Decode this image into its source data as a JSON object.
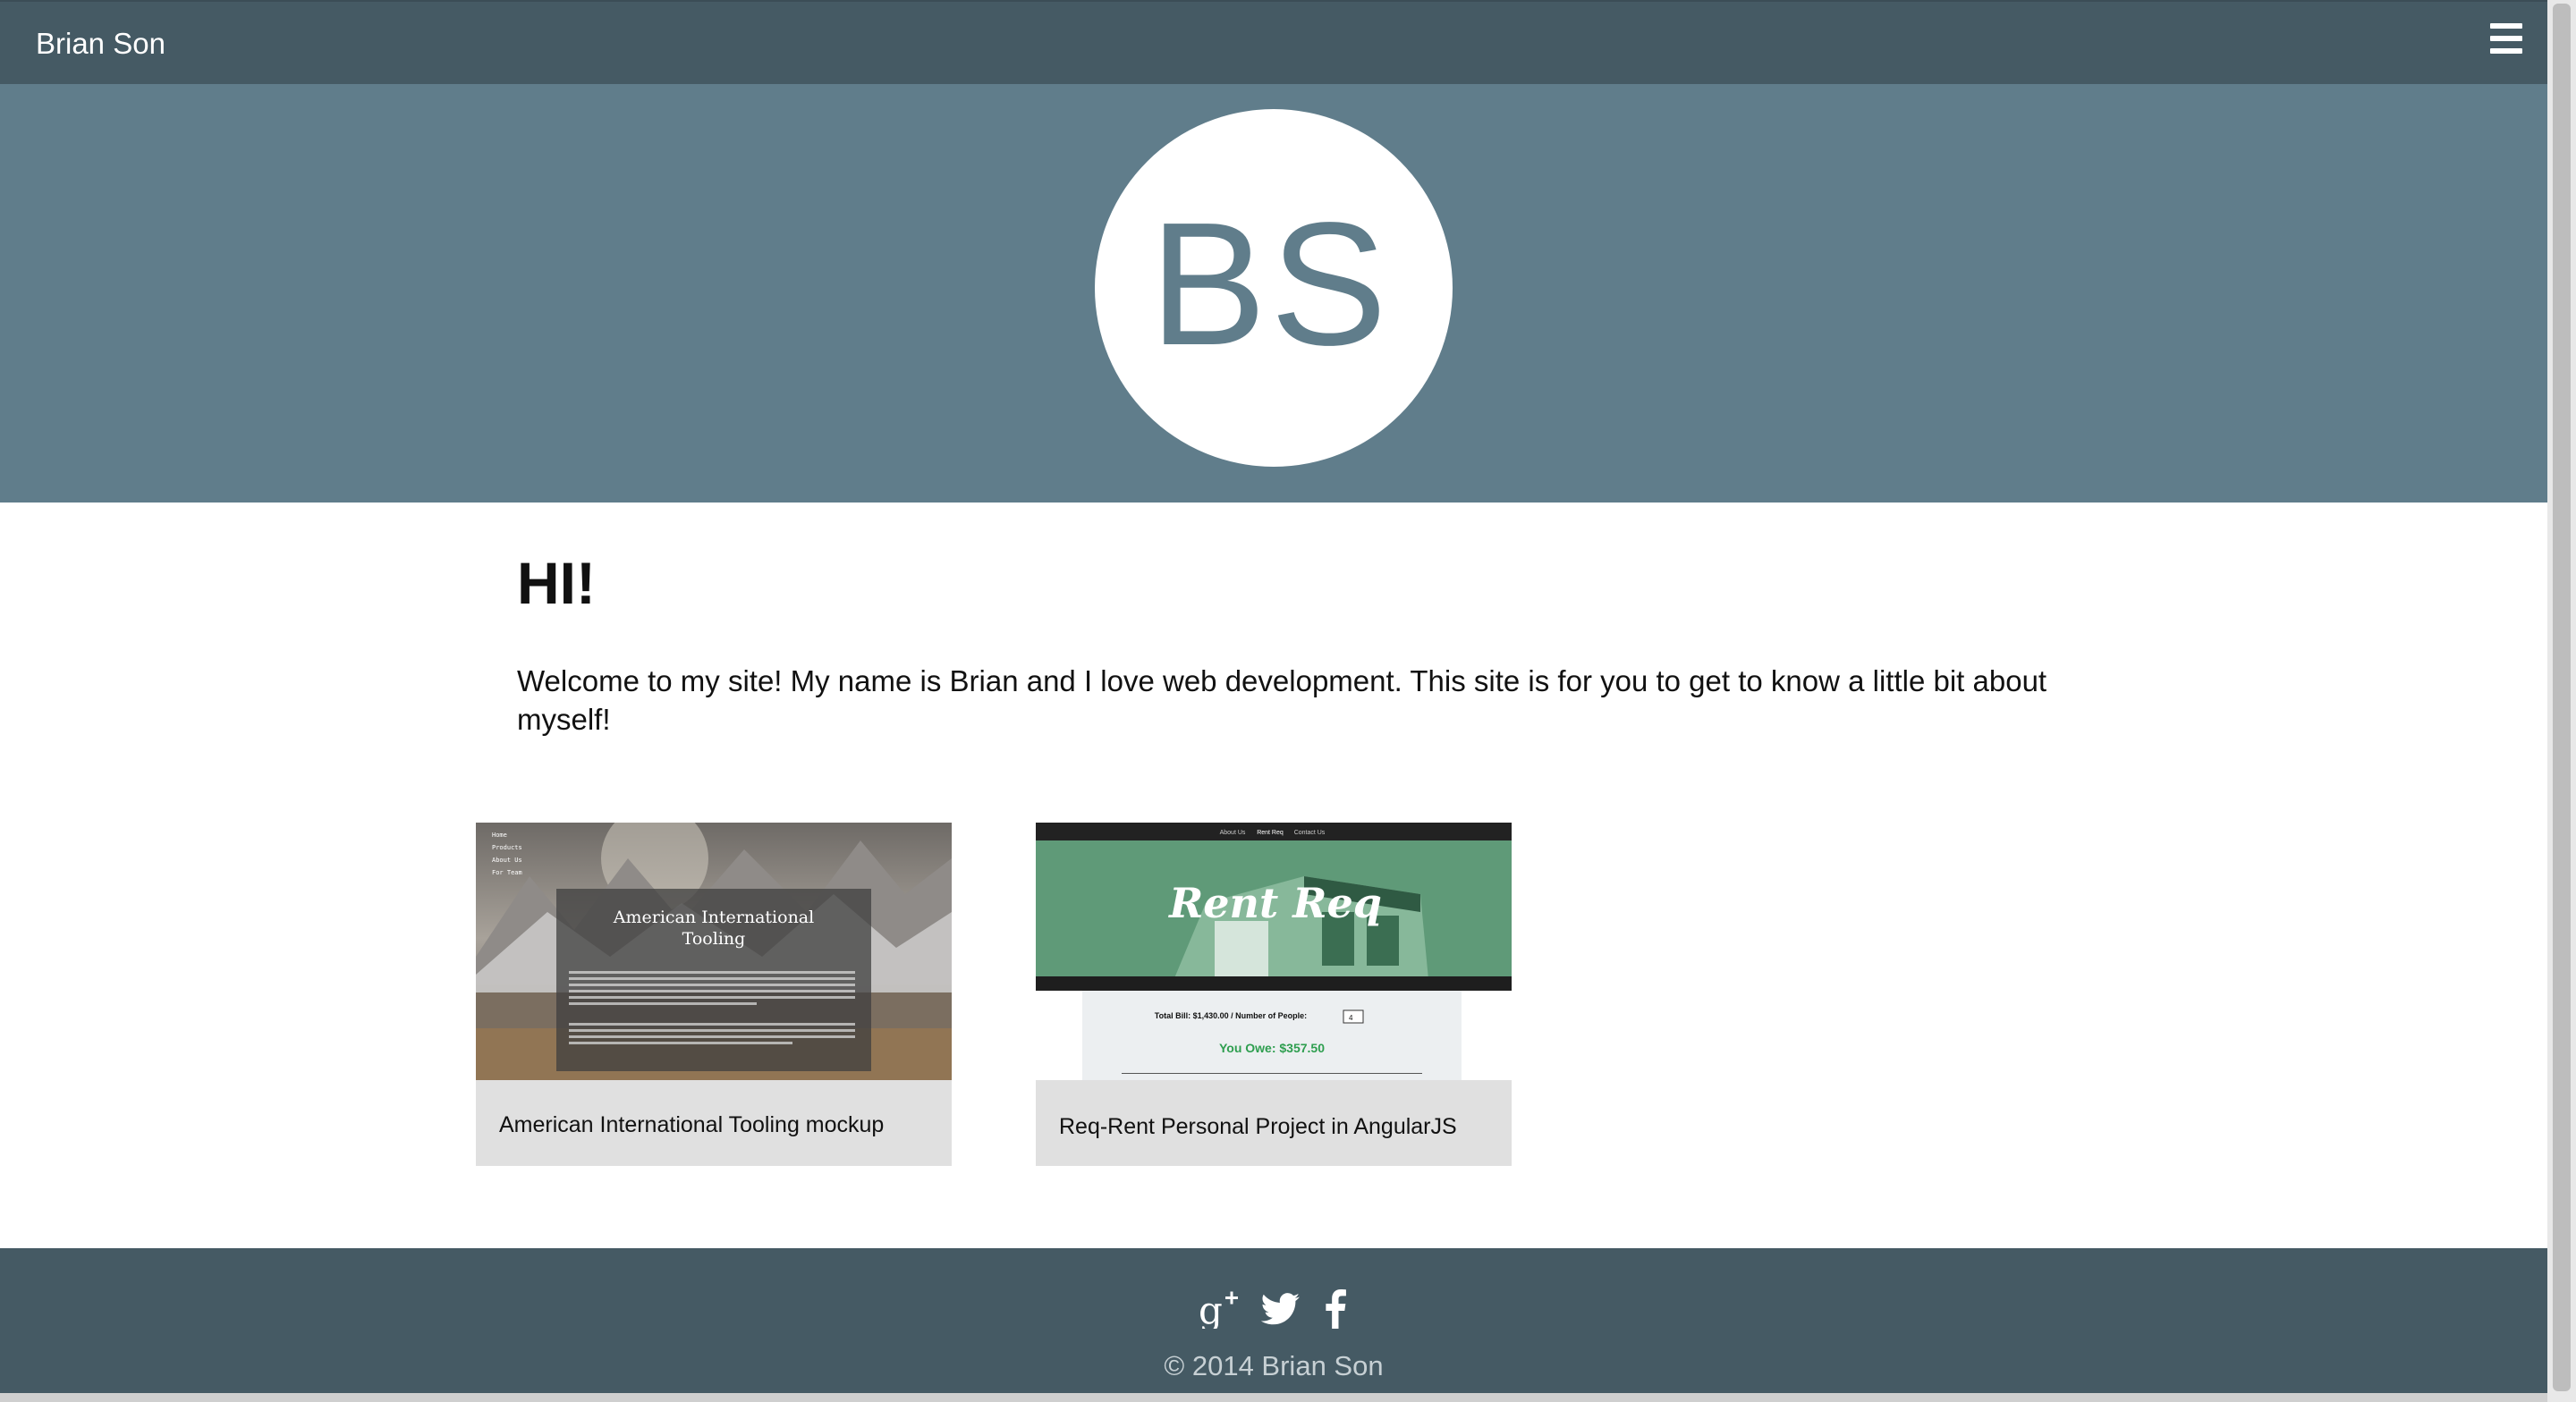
{
  "navbar": {
    "brand": "Brian Son",
    "menu_icon": "hamburger-menu-icon"
  },
  "hero": {
    "initials": "BS"
  },
  "main": {
    "heading": "HI!",
    "intro": "Welcome to my site! My name is Brian and I love web development. This site is for you to get to know a little bit about myself!"
  },
  "projects": [
    {
      "caption": "American International Tooling mockup",
      "thumb": {
        "nav": [
          "Home",
          "Products",
          "About Us",
          "For Team"
        ],
        "title_line1": "American International",
        "title_line2": "Tooling"
      }
    },
    {
      "caption": "Req-Rent Personal Project in AngularJS",
      "thumb": {
        "nav": [
          "About Us",
          "Rent Req",
          "Contact Us"
        ],
        "logo": "Rent Req",
        "bill_text": "Total Bill: $1,430.00 / Number of People:",
        "people": "4",
        "owe_text": "You Owe: $357.50"
      }
    }
  ],
  "footer": {
    "icons": [
      "google-plus-icon",
      "twitter-icon",
      "facebook-icon"
    ],
    "copyright": "© 2014 Brian Son"
  },
  "colors": {
    "navbar": "#455a64",
    "hero": "#607d8b",
    "card": "#e0e0e0",
    "footer": "#455a64",
    "owe_green": "#2e9e4f"
  }
}
